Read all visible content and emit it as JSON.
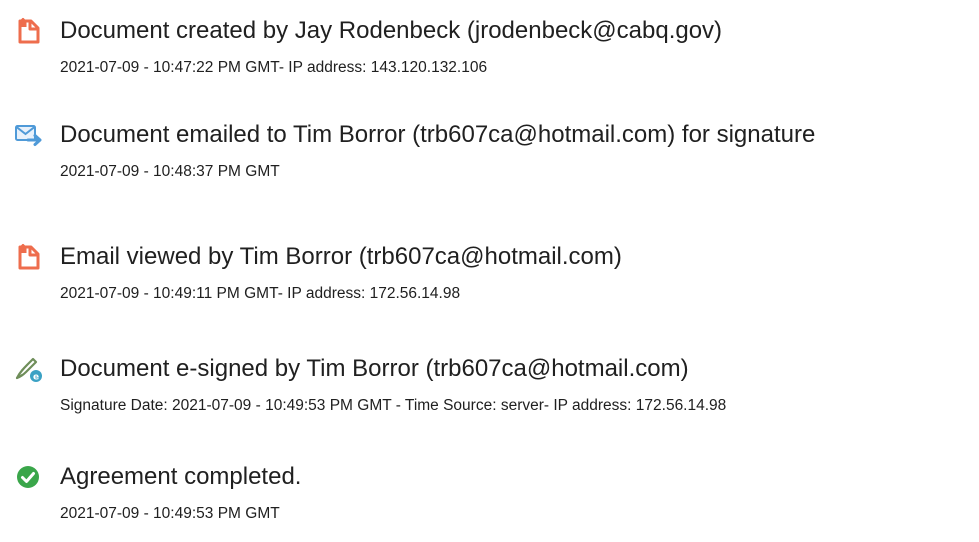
{
  "events": [
    {
      "icon": "document-icon",
      "title": "Document created by Jay Rodenbeck (jrodenbeck@cabq.gov)",
      "detail": "2021-07-09 - 10:47:22 PM GMT- IP address: 143.120.132.106"
    },
    {
      "icon": "email-sent-icon",
      "title": "Document emailed to Tim Borror (trb607ca@hotmail.com) for signature",
      "detail": "2021-07-09 - 10:48:37 PM GMT"
    },
    {
      "icon": "document-icon",
      "title": "Email viewed by Tim Borror (trb607ca@hotmail.com)",
      "detail": "2021-07-09 - 10:49:11 PM GMT- IP address: 172.56.14.98"
    },
    {
      "icon": "esign-pen-icon",
      "title": "Document e-signed by Tim Borror (trb607ca@hotmail.com)",
      "detail": "Signature Date: 2021-07-09 - 10:49:53 PM GMT - Time Source: server- IP address: 172.56.14.98"
    },
    {
      "icon": "check-circle-icon",
      "title": "Agreement completed.",
      "detail": "2021-07-09 - 10:49:53 PM GMT"
    }
  ],
  "colors": {
    "document_icon": "#ee6d4d",
    "email_icon": "#4f9ad8",
    "esign_icon_pen": "#6f8e5a",
    "esign_icon_badge": "#3aa1c4",
    "check_icon": "#3aa64a",
    "text": "#202020"
  }
}
